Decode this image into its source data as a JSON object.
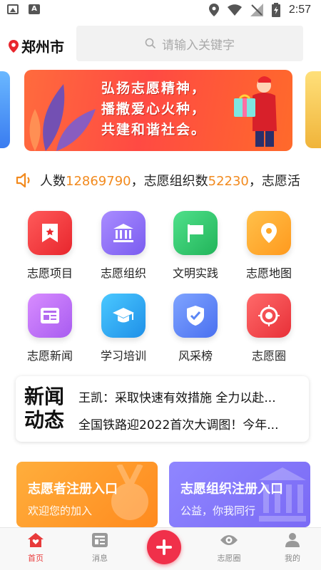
{
  "status_bar": {
    "time": "2:57"
  },
  "header": {
    "city": "郑州市",
    "search_placeholder": "请输入关键字"
  },
  "banner": {
    "lines": [
      "弘扬志愿精神，",
      "播撒爱心火种，",
      "共建和谐社会。"
    ]
  },
  "notice": {
    "prefix": "人数",
    "people_count": "12869790",
    "mid": "，志愿组织数",
    "org_count": "52230",
    "suffix": "，志愿活"
  },
  "grid": [
    {
      "label": "志愿项目",
      "icon": "bookmark-star-icon",
      "color": "#f0403e"
    },
    {
      "label": "志愿组织",
      "icon": "bank-building-icon",
      "color": "#8b6af4"
    },
    {
      "label": "文明实践",
      "icon": "flag-icon",
      "color": "#2ec46b"
    },
    {
      "label": "志愿地图",
      "icon": "map-pin-icon",
      "color": "#ffa726"
    },
    {
      "label": "志愿新闻",
      "icon": "newspaper-icon",
      "color": "#b36af0"
    },
    {
      "label": "学习培训",
      "icon": "graduation-cap-icon",
      "color": "#2ea8ee"
    },
    {
      "label": "风采榜",
      "icon": "shield-check-icon",
      "color": "#5b86f5"
    },
    {
      "label": "志愿圈",
      "icon": "target-icon",
      "color": "#ef4a50"
    }
  ],
  "news": {
    "logo_line1": "新闻",
    "logo_line2": "动态",
    "items": [
      "王凯：采取快速有效措施 全力以赴...",
      "全国铁路迎2022首次大调图！今年..."
    ]
  },
  "cards": [
    {
      "title": "志愿者注册入口",
      "subtitle": "欢迎您的加入",
      "color": "#ff9a2e"
    },
    {
      "title": "志愿组织注册入口",
      "subtitle": "公益，你我同行",
      "color": "#857af7"
    }
  ],
  "tabbar": {
    "tabs": [
      {
        "label": "首页",
        "icon": "home-heart-icon",
        "active": true
      },
      {
        "label": "消息",
        "icon": "message-list-icon",
        "active": false
      },
      {
        "label": "",
        "icon": "plus-icon",
        "active": false
      },
      {
        "label": "志愿圈",
        "icon": "eye-icon",
        "active": false
      },
      {
        "label": "我的",
        "icon": "user-icon",
        "active": false
      }
    ]
  },
  "colors": {
    "accent": "#e83b3b",
    "number": "#f28a1e"
  }
}
